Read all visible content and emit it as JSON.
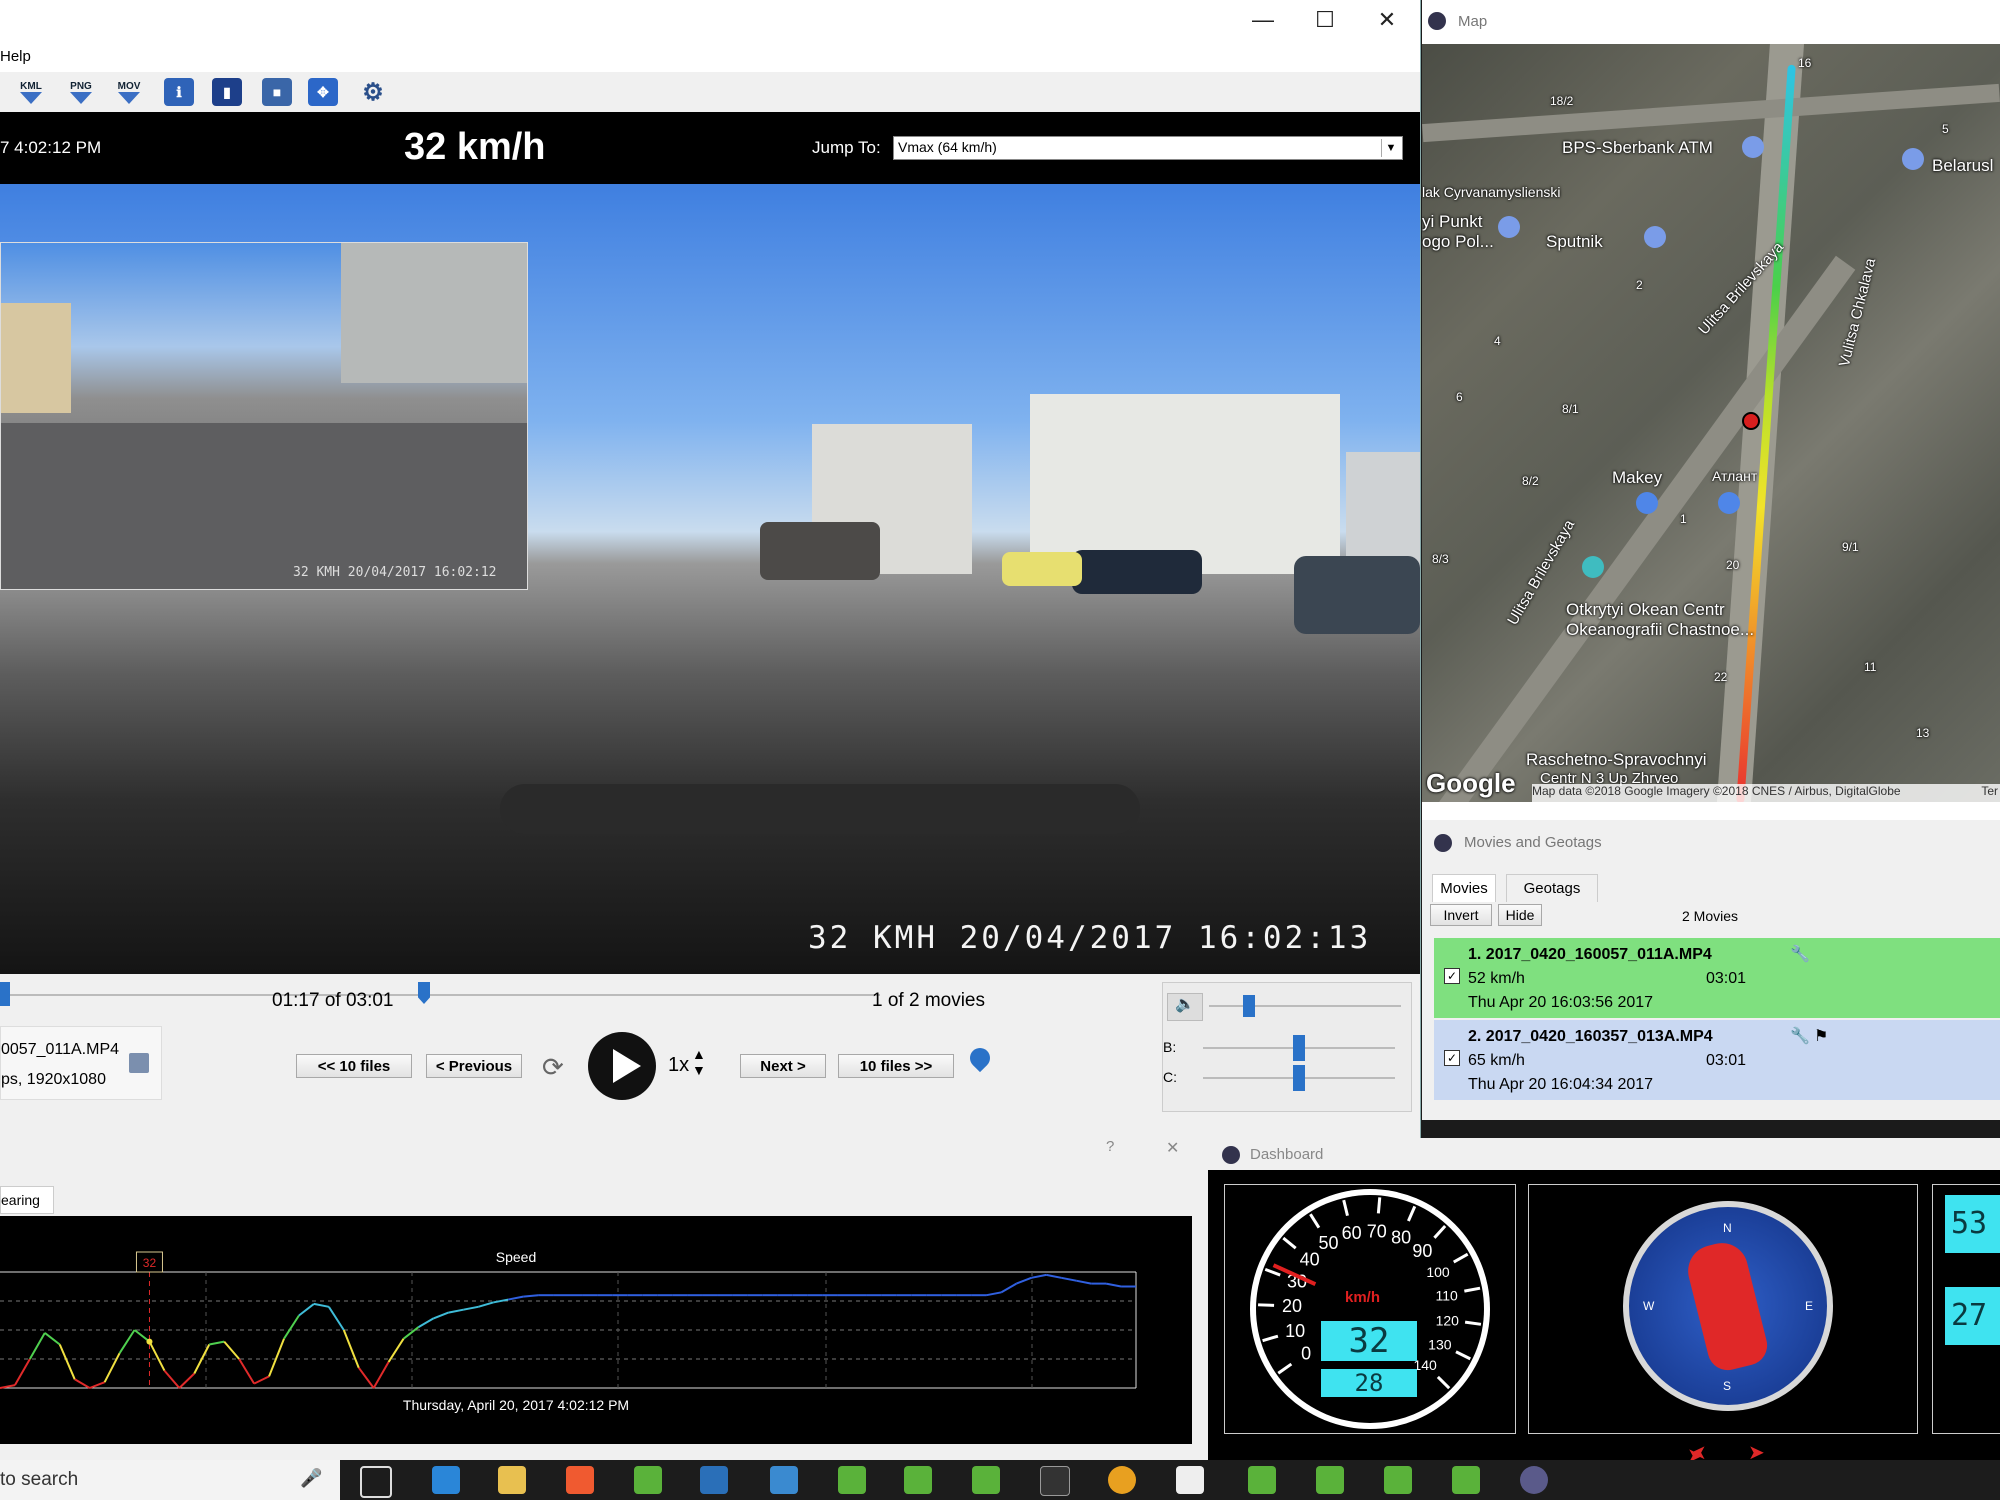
{
  "main_window": {
    "menu": {
      "help": "Help"
    },
    "toolbar": {
      "kml": "KML",
      "png": "PNG",
      "mov": "MOV"
    },
    "hud": {
      "time": "7 4:02:12 PM",
      "speed": "32 km/h",
      "jump_label": "Jump To:",
      "jump_value": "Vmax (64 km/h)"
    },
    "video": {
      "stamp": "32 KMH   20/04/2017  16:02:13",
      "pip_stamp": "32 KMH  20/04/2017  16:02:12"
    },
    "controls": {
      "position": "01:17 of 03:01",
      "movies_count": "1 of 2 movies",
      "file_name": "0057_011A.MP4",
      "file_info": "ps, 1920x1080",
      "back10": "<< 10 files",
      "previous": "< Previous",
      "next": "Next >",
      "fwd10": "10 files >>",
      "speed_mult": "1x",
      "b_label": "B:",
      "c_label": "C:"
    }
  },
  "map": {
    "title": "Map",
    "labels": {
      "atm": "BPS-Sberbank ATM",
      "belarus": "Belarusl",
      "lak": "lak Cyrvanamyslienski",
      "punkt": "yi Punkt",
      "pol": "ogo Pol...",
      "sputnik": "Sputnik",
      "brilevskaya1": "Ulitsa Brilevskaya",
      "chkalova1": "Vulitsa Chkalava",
      "makey": "Makey",
      "atlant": "Атлант",
      "brilevskaya2": "Ulitsa Brilevskaya",
      "okean1": "Otkrytyi Okean Centr",
      "okean2": "Okeanografii Chastnoe...",
      "raschetno1": "Raschetno-Spravochnyi",
      "raschetno2": "Centr N 3 Up Zhrveo",
      "google": "Google",
      "attribution": "Map data ©2018 Google Imagery ©2018 CNES / Airbus, DigitalGlobe",
      "terms": "Ter",
      "n182": "18/2",
      "n16": "16",
      "n5": "5",
      "n2": "2",
      "n4": "4",
      "n6": "6",
      "n81": "8/1",
      "n82": "8/2",
      "n1": "1",
      "n83": "8/3",
      "n20": "20",
      "n91": "9/1",
      "n11": "11",
      "n22": "22",
      "n13": "13"
    }
  },
  "movies_panel": {
    "title": "Movies and Geotags",
    "tabs": [
      "Movies",
      "Geotags"
    ],
    "invert": "Invert",
    "hide": "Hide",
    "count": "2 Movies",
    "entries": [
      {
        "name": "1. 2017_0420_160057_011A.MP4",
        "speed": "52 km/h",
        "duration": "03:01",
        "date": "Thu Apr 20 16:03:56 2017",
        "color": "#7fe07f"
      },
      {
        "name": "2. 2017_0420_160357_013A.MP4",
        "speed": "65 km/h",
        "duration": "03:01",
        "date": "Thu Apr 20 16:04:34 2017",
        "color": "#c9d8f2"
      }
    ]
  },
  "chart_window": {
    "tab": "earing",
    "help": "?",
    "close": "✕"
  },
  "chart_data": {
    "type": "line",
    "title": "Speed",
    "xlabel": "Thursday, April 20, 2017 4:02:12 PM",
    "ylabel": "",
    "marker_label": "32",
    "series": [
      {
        "values": [
          0,
          2,
          20,
          38,
          30,
          6,
          0,
          4,
          24,
          40,
          32,
          12,
          0,
          10,
          30,
          32,
          20,
          3,
          8,
          34,
          50,
          58,
          56,
          40,
          14,
          0,
          18,
          34,
          42,
          48,
          52,
          54,
          56,
          59,
          61,
          63,
          64,
          64,
          64,
          64,
          64,
          64,
          64,
          64,
          64,
          64,
          64,
          64,
          64,
          64,
          64,
          64,
          64,
          64,
          64,
          64,
          64,
          64,
          64,
          64,
          64,
          64,
          64,
          64,
          64,
          64,
          64,
          66,
          72,
          76,
          78,
          76,
          74,
          72,
          72,
          70,
          70
        ]
      }
    ]
  },
  "dashboard": {
    "title": "Dashboard",
    "unit": "km/h",
    "speed": "32",
    "avg": "28",
    "ticks": [
      "0",
      "10",
      "20",
      "30",
      "40",
      "50",
      "60",
      "70",
      "80",
      "90",
      "100",
      "110",
      "120",
      "130",
      "140"
    ],
    "compass": [
      "N",
      "E",
      "S",
      "W"
    ],
    "right1": "53",
    "right2": "27"
  },
  "taskbar": {
    "search": "to search"
  }
}
